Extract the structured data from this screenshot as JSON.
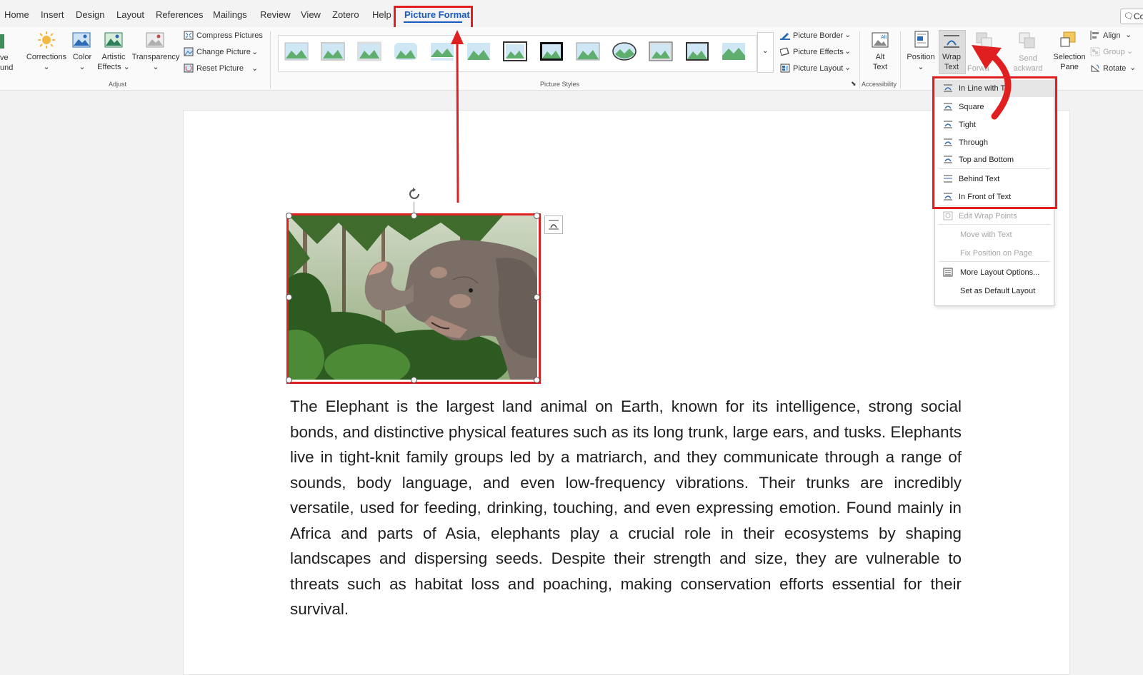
{
  "tabs": [
    "Home",
    "Insert",
    "Design",
    "Layout",
    "References",
    "Mailings",
    "Review",
    "View",
    "Zotero",
    "Help",
    "Picture Format"
  ],
  "active_tab": "Picture Format",
  "comments_label": "Co",
  "ribbon": {
    "remove_bg": [
      "ve",
      "und"
    ],
    "corrections": "Corrections",
    "color": "Color",
    "artistic_effects": [
      "Artistic",
      "Effects"
    ],
    "transparency": "Transparency",
    "compress": "Compress Pictures",
    "change_picture": "Change Picture",
    "reset_picture": "Reset Picture",
    "adjust_group": "Adjust",
    "picture_styles_group": "Picture Styles",
    "picture_border": "Picture Border",
    "picture_effects": "Picture Effects",
    "picture_layout": "Picture Layout",
    "alt_text": [
      "Alt",
      "Text"
    ],
    "accessibility_group": "Accessibility",
    "position": "Position",
    "wrap_text": [
      "Wrap",
      "Text"
    ],
    "bring_forward": "Forwa",
    "send_backward": [
      "Send",
      "ackward"
    ],
    "selection_pane": [
      "Selection",
      "Pane"
    ],
    "align": "Align",
    "group": "Group",
    "rotate": "Rotate"
  },
  "wrap_menu": {
    "items": [
      {
        "label": "In Line with Te",
        "enabled": true
      },
      {
        "label": "Square",
        "enabled": true
      },
      {
        "label": "Tight",
        "enabled": true
      },
      {
        "label": "Through",
        "enabled": true
      },
      {
        "label": "Top and Bottom",
        "enabled": true
      },
      {
        "label": "Behind Text",
        "enabled": true
      },
      {
        "label": "In Front of Text",
        "enabled": true
      },
      {
        "label": "Edit Wrap Points",
        "enabled": false
      },
      {
        "label": "Move with Text",
        "enabled": false
      },
      {
        "label": "Fix Position on Page",
        "enabled": false
      },
      {
        "label": "More Layout Options...",
        "enabled": true
      },
      {
        "label": "Set as Default Layout",
        "enabled": true
      }
    ]
  },
  "document": {
    "paragraph": "The Elephant is the largest land animal on Earth, known for its intelligence, strong social bonds, and distinctive physical features such as its long trunk, large ears, and tusks. Elephants live in tight-knit family groups led by a matriarch, and they communicate through a range of sounds, body language, and even low-frequency vibrations. Their trunks are incredibly versatile, used for feeding, drinking, touching, and even expressing emotion. Found mainly in Africa and parts of Asia, elephants play a crucial role in their ecosystems by shaping landscapes and dispersing seeds. Despite their strength and size, they are vulnerable to threats such as habitat loss and poaching, making conservation efforts essential for their survival."
  },
  "colors": {
    "accent": "#185abd",
    "annotation_red": "#e02020"
  }
}
